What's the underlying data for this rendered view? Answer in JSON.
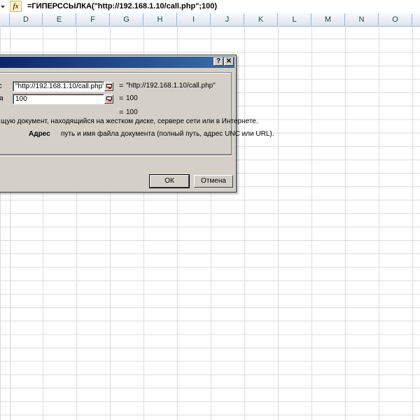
{
  "formula_bar": {
    "fx_label": "fx",
    "formula": "=ГИПЕРССЫЛКА(\"http://192.168.1.10/call.php\";100)"
  },
  "columns": [
    "D",
    "E",
    "F",
    "G",
    "H",
    "I",
    "J",
    "K",
    "L",
    "M",
    "N",
    "O"
  ],
  "dialog": {
    "help_button": "?",
    "close_button": "✕",
    "arg1": {
      "label": "ес",
      "value": "\"http://192.168.1.10/call.php\"",
      "equals": "=",
      "result": "\"http://192.168.1.10/call.php\""
    },
    "arg2": {
      "label": "мя",
      "value": "100",
      "equals": "=",
      "result": "100"
    },
    "function_result": {
      "equals": "=",
      "value": "100"
    },
    "description": "щую документ, находящийся на жестком диске, сервере сети или в Интернете.",
    "arg_help_name": "Адрес",
    "arg_help_text": "путь и имя файла документа (полный путь, адрес UNC или URL).",
    "ok_label": "ОК",
    "cancel_label": "Отмена"
  },
  "colors": {
    "titlebar_start": "#0a246a",
    "titlebar_end": "#3a6ea5",
    "dialog_face": "#d4d0c8",
    "gridline": "#dadcdd"
  }
}
